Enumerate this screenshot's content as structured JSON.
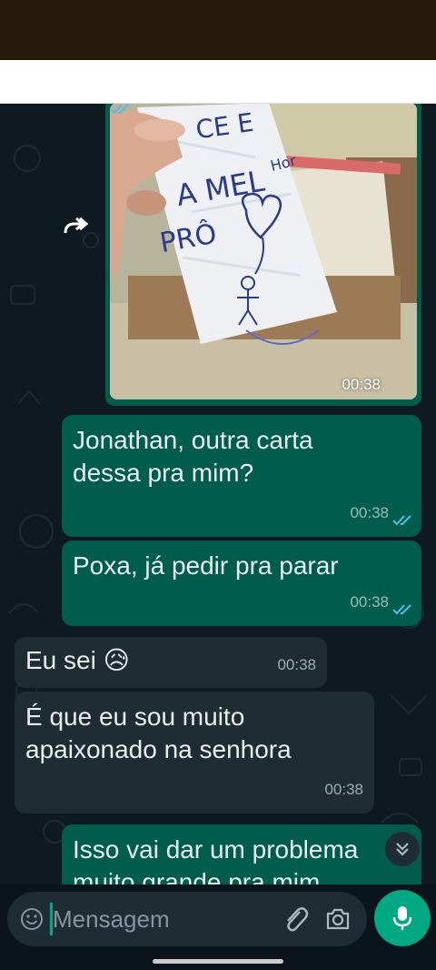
{
  "image_message": {
    "time": "00:38",
    "status": "read"
  },
  "messages": [
    {
      "direction": "out",
      "text": "Jonathan, outra carta\ndessa pra mim?",
      "time": "00:38",
      "status": "read"
    },
    {
      "direction": "out",
      "text": "Poxa, já pedir pra parar",
      "time": "00:38",
      "status": "read"
    },
    {
      "direction": "in",
      "text": "Eu sei 😥",
      "time": "00:38"
    },
    {
      "direction": "in",
      "text": "É que eu sou muito\napaixonado na senhora",
      "time": "00:38"
    },
    {
      "direction": "out",
      "text": "Isso vai dar um problema\nmuito grande pra mim",
      "time": ""
    }
  ],
  "composer": {
    "placeholder": "Mensagem"
  },
  "icons": [
    "forward-icon",
    "emoji-icon",
    "attach-icon",
    "camera-icon",
    "mic-icon",
    "chevron-double-down-icon",
    "double-check-icon"
  ],
  "colors": {
    "outgoing_bubble": "#005c4b",
    "incoming_bubble": "#202c33",
    "accent": "#00a884",
    "read_ticks": "#53bdeb"
  }
}
